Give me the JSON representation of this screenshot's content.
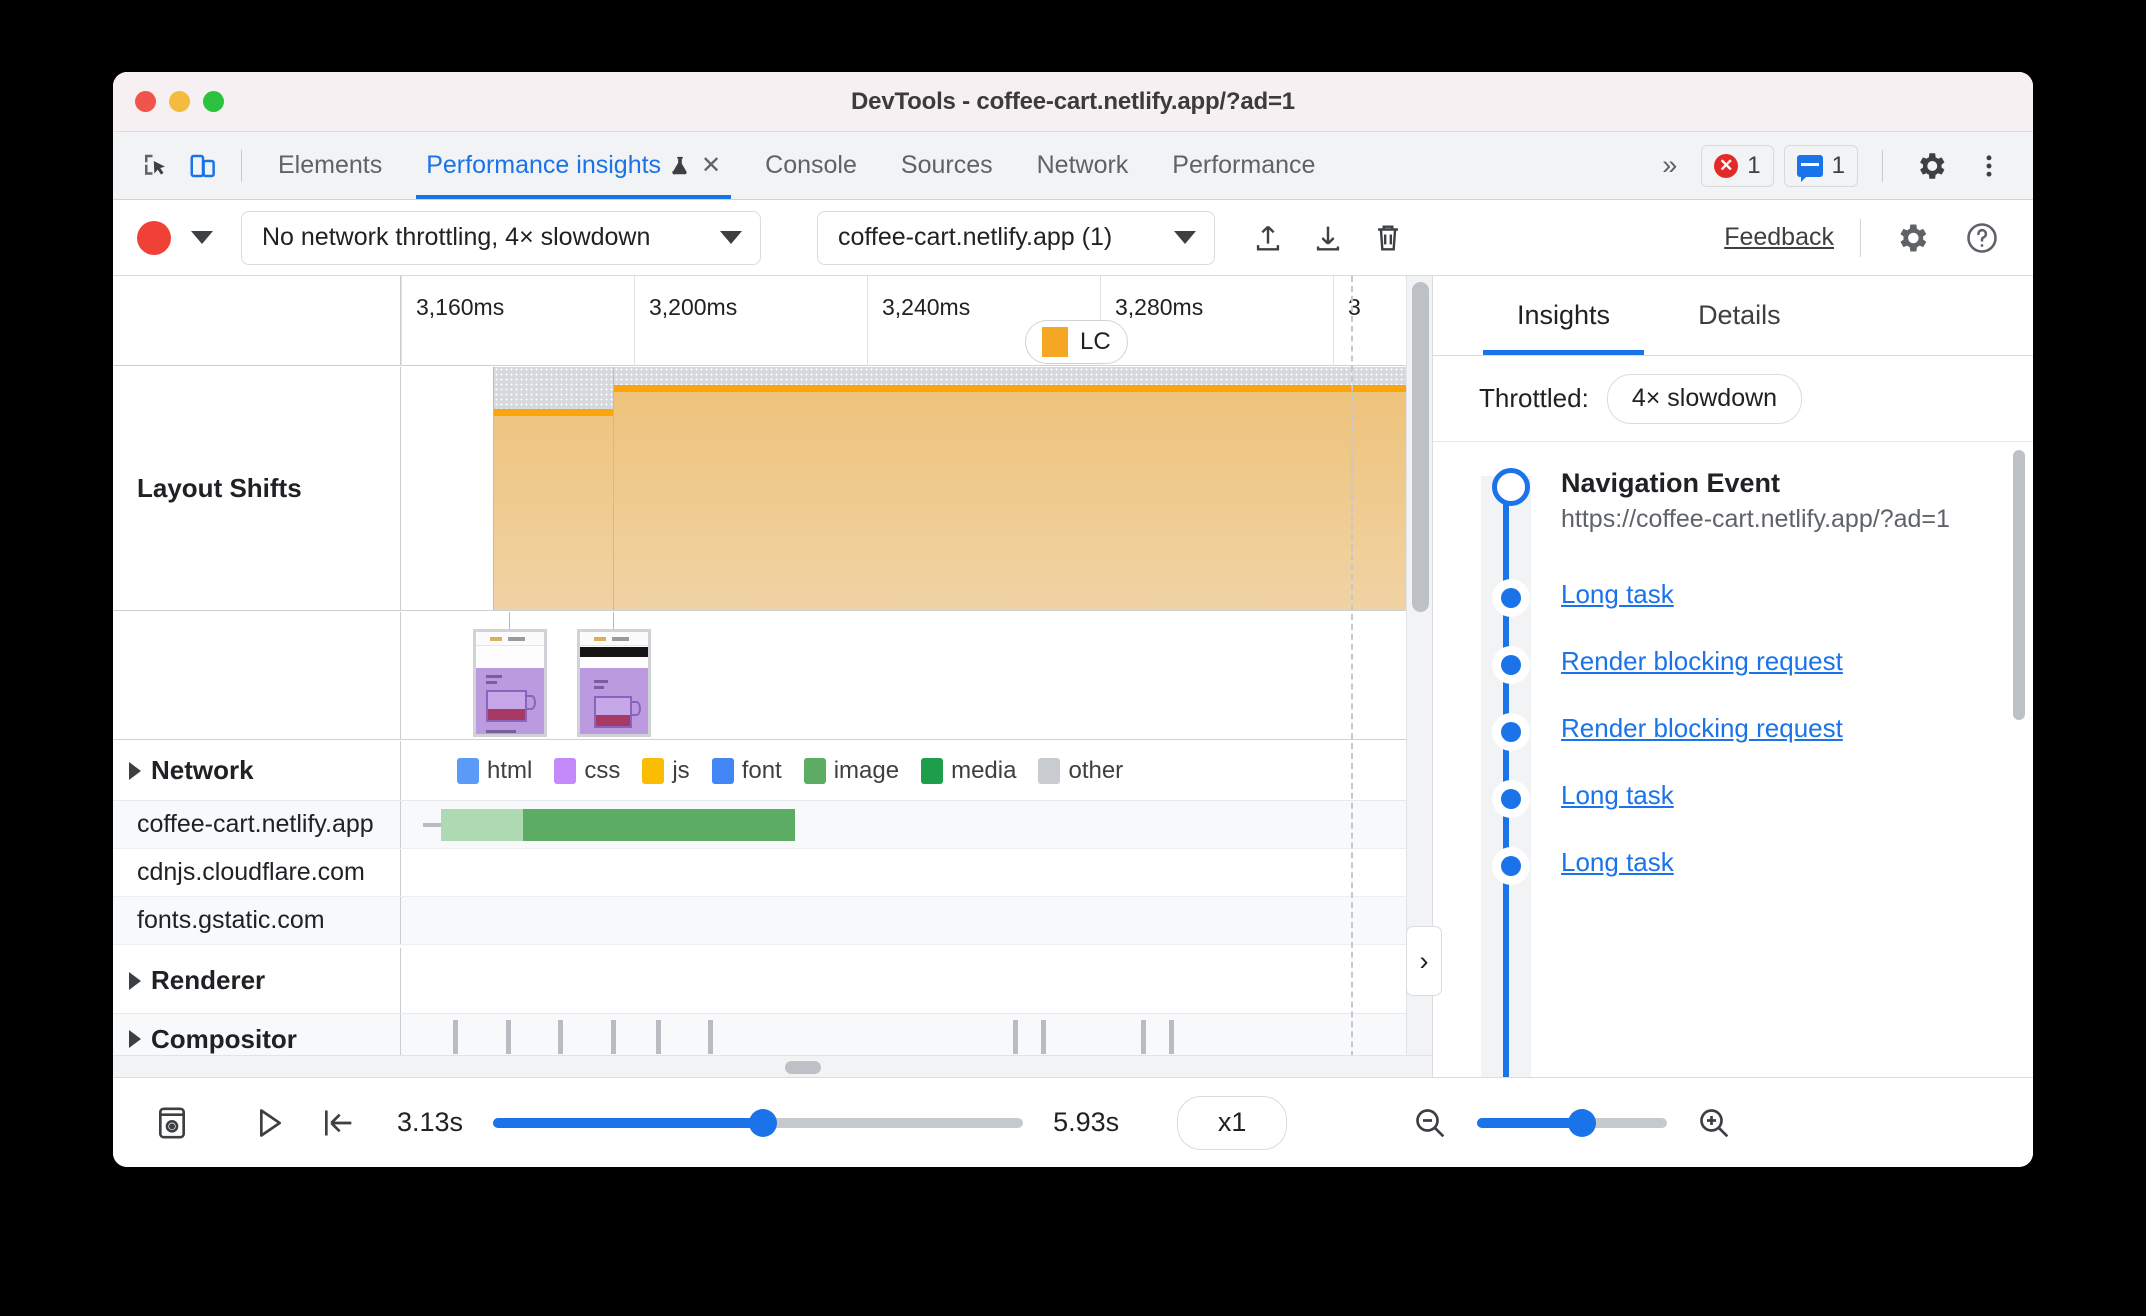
{
  "window": {
    "title": "DevTools - coffee-cart.netlify.app/?ad=1",
    "traffic_lights": [
      "close",
      "minimize",
      "maximize"
    ]
  },
  "tabbar": {
    "icons": [
      "inspect-element-icon",
      "device-toolbar-icon"
    ],
    "tabs": [
      {
        "label": "Elements",
        "active": false
      },
      {
        "label": "Performance insights",
        "active": true,
        "experimental": true,
        "closable": true
      },
      {
        "label": "Console",
        "active": false
      },
      {
        "label": "Sources",
        "active": false
      },
      {
        "label": "Network",
        "active": false
      },
      {
        "label": "Performance",
        "active": false
      }
    ],
    "overflow_label": "»",
    "error_count": "1",
    "message_count": "1",
    "settings_icon": "gear-icon",
    "menu_icon": "kebab-menu-icon"
  },
  "toolbar": {
    "record_label": "record-button",
    "throttle_value": "No network throttling, 4× slowdown",
    "target_value": "coffee-cart.netlify.app (1)",
    "upload_icon": "upload-icon",
    "download_icon": "download-icon",
    "delete_icon": "trash-icon",
    "feedback_label": "Feedback",
    "settings_icon": "gear-icon",
    "help_icon": "help-icon"
  },
  "timeline": {
    "ruler_ticks": [
      "3,160ms",
      "3,200ms",
      "3,240ms",
      "3,280ms",
      "3"
    ],
    "lcp_marker": "LC",
    "rows": [
      {
        "name": "Layout Shifts"
      },
      {
        "name": "Network"
      },
      {
        "name": "Renderer"
      },
      {
        "name": "Compositor"
      }
    ],
    "network_legend": [
      {
        "label": "html",
        "color": "#5b9bf8"
      },
      {
        "label": "css",
        "color": "#c58af9"
      },
      {
        "label": "js",
        "color": "#fbbc04"
      },
      {
        "label": "font",
        "color": "#4285f4"
      },
      {
        "label": "image",
        "color": "#5cad63"
      },
      {
        "label": "media",
        "color": "#1e9e4a"
      },
      {
        "label": "other",
        "color": "#c8ccd0"
      }
    ],
    "network_rows": [
      {
        "domain": "coffee-cart.netlify.app",
        "has_request": true
      },
      {
        "domain": "cdnjs.cloudflare.com",
        "has_request": false
      },
      {
        "domain": "fonts.gstatic.com",
        "has_request": false
      }
    ],
    "collapse_handle": "chevron-right-icon"
  },
  "sidebar": {
    "tabs": [
      {
        "label": "Insights",
        "active": true
      },
      {
        "label": "Details",
        "active": false
      }
    ],
    "throttled_label": "Throttled:",
    "throttled_value": "4× slowdown",
    "items": [
      {
        "type": "event",
        "title": "Navigation Event",
        "url": "https://coffee-cart.netlify.app/?ad=1"
      },
      {
        "type": "link",
        "label": "Long task"
      },
      {
        "type": "link",
        "label": "Render blocking request"
      },
      {
        "type": "link",
        "label": "Render blocking request"
      },
      {
        "type": "link",
        "label": "Long task"
      },
      {
        "type": "link",
        "label": "Long task"
      }
    ]
  },
  "bottombar": {
    "screenshot_icon": "filmstrip-icon",
    "play_icon": "play-icon",
    "jump-to-start_icon": "jump-to-start-icon",
    "start_time": "3.13s",
    "end_time": "5.93s",
    "playback_progress_pct": 51,
    "rate": "x1",
    "zoom_out_icon": "zoom-out-icon",
    "zoom_in_icon": "zoom-in-icon",
    "zoom_level_pct": 55
  },
  "colors": {
    "accent": "#1a73e8",
    "record": "#ef4136",
    "layout_shift": "#f0c179",
    "layout_shift_cap": "#fba40b",
    "error": "#e22a29"
  }
}
